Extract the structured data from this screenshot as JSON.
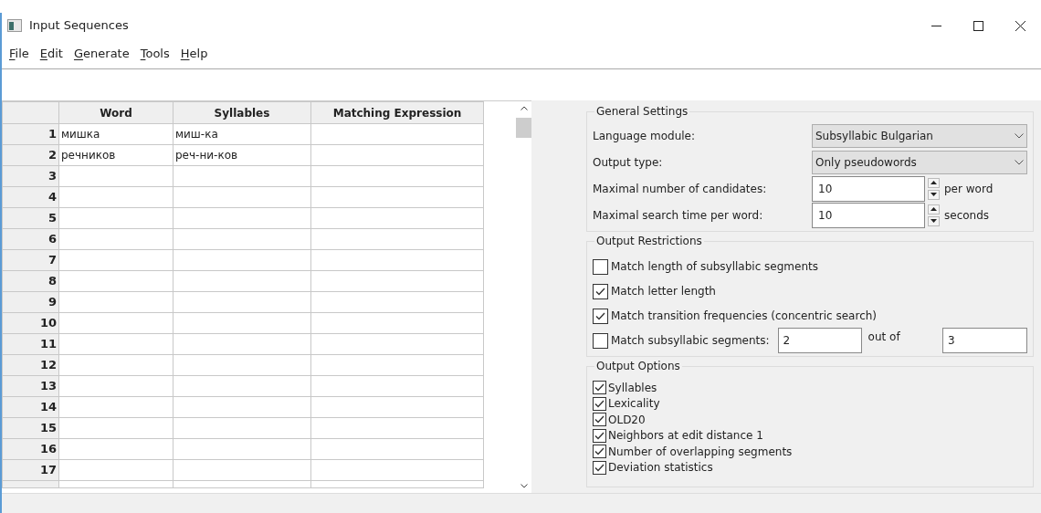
{
  "window": {
    "title": "Input Sequences"
  },
  "menu": [
    {
      "mnemonic": "F",
      "rest": "ile"
    },
    {
      "mnemonic": "E",
      "rest": "dit"
    },
    {
      "mnemonic": "G",
      "rest": "enerate"
    },
    {
      "mnemonic": "T",
      "rest": "ools"
    },
    {
      "mnemonic": "H",
      "rest": "elp"
    }
  ],
  "table": {
    "columns": [
      "Word",
      "Syllables",
      "Matching Expression"
    ],
    "rows": [
      {
        "number": "1",
        "cells": [
          "мишка",
          "миш-ка",
          ""
        ]
      },
      {
        "number": "2",
        "cells": [
          "речников",
          "реч-ни-ков",
          ""
        ]
      },
      {
        "number": "3",
        "cells": [
          "",
          "",
          ""
        ]
      },
      {
        "number": "4",
        "cells": [
          "",
          "",
          ""
        ]
      },
      {
        "number": "5",
        "cells": [
          "",
          "",
          ""
        ]
      },
      {
        "number": "6",
        "cells": [
          "",
          "",
          ""
        ]
      },
      {
        "number": "7",
        "cells": [
          "",
          "",
          ""
        ]
      },
      {
        "number": "8",
        "cells": [
          "",
          "",
          ""
        ]
      },
      {
        "number": "9",
        "cells": [
          "",
          "",
          ""
        ]
      },
      {
        "number": "10",
        "cells": [
          "",
          "",
          ""
        ]
      },
      {
        "number": "11",
        "cells": [
          "",
          "",
          ""
        ]
      },
      {
        "number": "12",
        "cells": [
          "",
          "",
          ""
        ]
      },
      {
        "number": "13",
        "cells": [
          "",
          "",
          ""
        ]
      },
      {
        "number": "14",
        "cells": [
          "",
          "",
          ""
        ]
      },
      {
        "number": "15",
        "cells": [
          "",
          "",
          ""
        ]
      },
      {
        "number": "16",
        "cells": [
          "",
          "",
          ""
        ]
      },
      {
        "number": "17",
        "cells": [
          "",
          "",
          ""
        ]
      }
    ]
  },
  "general_settings": {
    "title": "General Settings",
    "rows": [
      {
        "kind": "select",
        "label": "Language module:",
        "value": "Subsyllabic Bulgarian"
      },
      {
        "kind": "select",
        "label": "Output type:",
        "value": "Only pseudowords"
      },
      {
        "kind": "spin",
        "label": "Maximal number of candidates:",
        "value": "10",
        "unit": "per word"
      },
      {
        "kind": "spin",
        "label": "Maximal search time per word:",
        "value": "10",
        "unit": "seconds"
      }
    ]
  },
  "output_restrictions": {
    "title": "Output Restrictions",
    "items": [
      {
        "kind": "check",
        "label": "Match length of subsyllabic segments",
        "checked": false
      },
      {
        "kind": "check",
        "label": "Match letter length",
        "checked": true
      },
      {
        "kind": "check",
        "label": "Match transition frequencies (concentric search)",
        "checked": true
      },
      {
        "kind": "range",
        "label": "Match subsyllabic segments:",
        "checked": false,
        "value": "2",
        "between": "out of",
        "total": "3"
      }
    ]
  },
  "output_options": {
    "title": "Output Options",
    "items": [
      {
        "label": "Syllables",
        "checked": true
      },
      {
        "label": "Lexicality",
        "checked": true
      },
      {
        "label": "OLD20",
        "checked": true
      },
      {
        "label": "Neighbors at edit distance 1",
        "checked": true
      },
      {
        "label": "Number of overlapping segments",
        "checked": true
      },
      {
        "label": "Deviation statistics",
        "checked": true
      }
    ]
  }
}
